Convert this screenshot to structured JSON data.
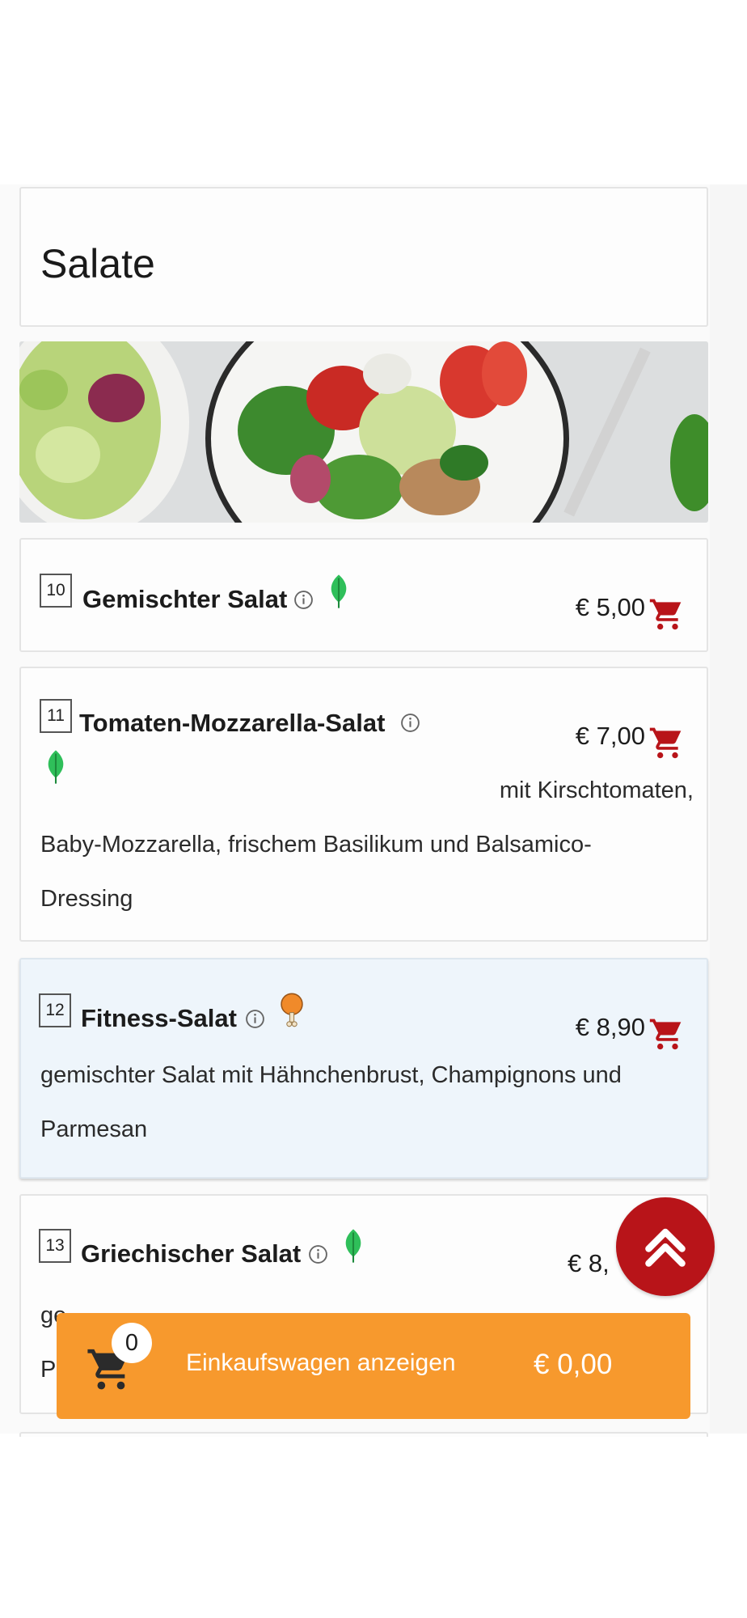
{
  "category": {
    "title": "Salate"
  },
  "banner": {
    "icon": "salad-photo"
  },
  "currency": "€",
  "items": [
    {
      "number": "10",
      "name": "Gemischter Salat",
      "price": "€ 5,00",
      "diet_icon": "leaf-icon",
      "description": ""
    },
    {
      "number": "11",
      "name": "Tomaten-Mozzarella-Salat",
      "price": "€ 7,00",
      "diet_icon": "leaf-icon",
      "description_line1": "mit Kirschtomaten,",
      "description_line2": "Baby-Mozzarella, frischem Basilikum und Balsamico-",
      "description_line3": "Dressing"
    },
    {
      "number": "12",
      "name": "Fitness-Salat",
      "price": "€ 8,90",
      "diet_icon": "chicken-leg-icon",
      "description_line1": "gemischter Salat mit Hähnchenbrust, Champignons und",
      "description_line2": "Parmesan"
    },
    {
      "number": "13",
      "name": "Griechischer Salat",
      "price": "€ 8,",
      "diet_icon": "leaf-icon",
      "description_line1": "ge",
      "description_line2": "P"
    }
  ],
  "cart": {
    "count": "0",
    "label": "Einkaufswagen anzeigen",
    "total": "€ 0,00"
  },
  "colors": {
    "accent_red": "#b81419",
    "cart_orange": "#f7992d",
    "leaf_green": "#2fbf5a",
    "highlight_row": "#eef5fb"
  }
}
